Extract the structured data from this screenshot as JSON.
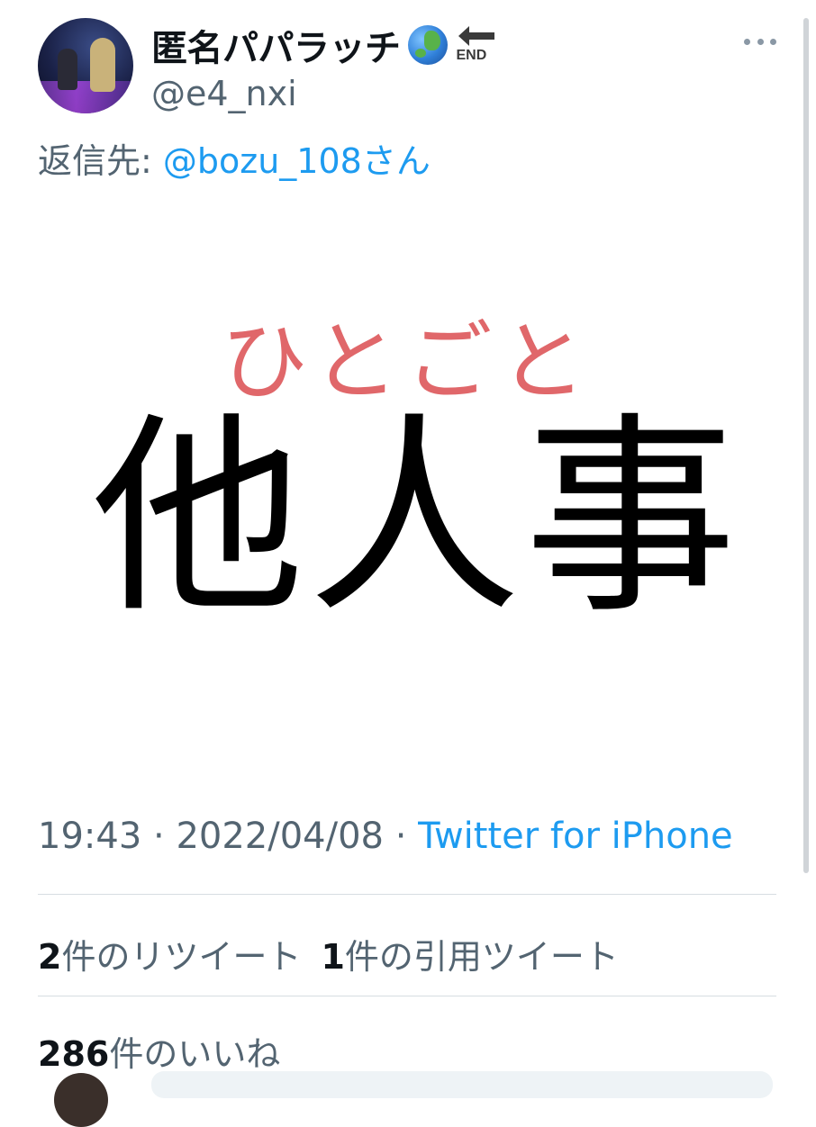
{
  "tweet": {
    "author": {
      "display_name": "匿名パパラッチ",
      "handle": "@e4_nxi",
      "name_icons": [
        "globe-asia-australia-icon",
        "end-arrow-icon"
      ],
      "end_icon_text": "END"
    },
    "reply_to": {
      "prefix": "返信先: ",
      "mention": "@bozu_108さん"
    },
    "media": {
      "furigana": "ひとごと",
      "kanji": "他人事"
    },
    "timestamp": {
      "time": "19:43",
      "separator": " · ",
      "date": "2022/04/08",
      "source": "Twitter for iPhone"
    },
    "stats": {
      "retweets_count": "2",
      "retweets_label": "件のリツイート",
      "quotes_count": "1",
      "quotes_label": "件の引用ツイート",
      "likes_count": "286",
      "likes_label": "件のいいね"
    }
  },
  "colors": {
    "link_blue": "#1d9bf0",
    "secondary_text": "#536471",
    "primary_text": "#0f1419",
    "furigana_red": "#e0676a"
  }
}
